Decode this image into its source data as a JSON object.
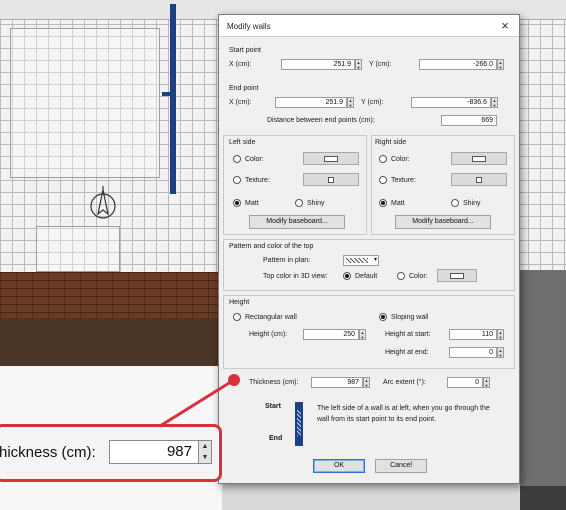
{
  "dialog": {
    "title": "Modify walls",
    "close_icon": "×",
    "start_point": {
      "heading": "Start point",
      "x_label": "X (cm):",
      "x_value": "251.9",
      "y_label": "Y (cm):",
      "y_value": "-266.0"
    },
    "end_point": {
      "heading": "End point",
      "x_label": "X (cm):",
      "x_value": "251.9",
      "y_label": "Y (cm):",
      "y_value": "-836.6",
      "distance_label": "Distance between end points (cm):",
      "distance_value": "669"
    },
    "left_side": {
      "heading": "Left side",
      "color_label": "Color:",
      "texture_label": "Texture:",
      "matt_label": "Matt",
      "shiny_label": "Shiny",
      "modify_baseboard": "Modify baseboard..."
    },
    "right_side": {
      "heading": "Right side",
      "color_label": "Color:",
      "texture_label": "Texture:",
      "matt_label": "Matt",
      "shiny_label": "Shiny",
      "modify_baseboard": "Modify baseboard..."
    },
    "top": {
      "heading": "Pattern and color of the top",
      "pattern_label": "Pattern in plan:",
      "top_color_label": "Top color in 3D view:",
      "default_label": "Default",
      "color_label": "Color:"
    },
    "height": {
      "heading": "Height",
      "rectangular_label": "Rectangular wall",
      "height_label": "Height (cm):",
      "height_value": "250",
      "sloping_label": "Sloping wall",
      "height_start_label": "Height at start:",
      "height_start_value": "110",
      "height_end_label": "Height at end:",
      "height_end_value": "0"
    },
    "thickness_label": "Thickness (cm):",
    "thickness_value": "987",
    "arc_label": "Arc extent (°):",
    "arc_value": "0",
    "preview": {
      "start_label": "Start",
      "end_label": "End",
      "hint": "The left side of a wall is at left, when you go through the wall from its start point to its end point."
    },
    "ok_label": "OK",
    "cancel_label": "Cancel"
  },
  "callout": {
    "label": "hickness (cm):",
    "value": "987"
  },
  "colors": {
    "callout_red": "#d9303a",
    "wall_blue": "#1d3f85"
  }
}
